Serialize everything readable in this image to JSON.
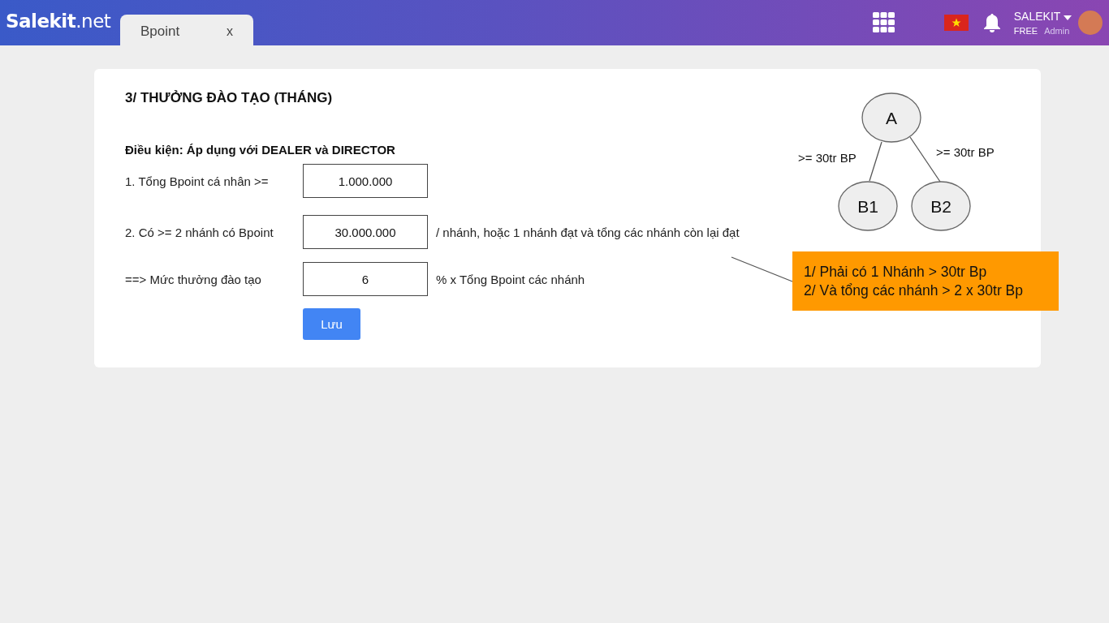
{
  "header": {
    "logo_main": "Salekit",
    "logo_suffix": ".net",
    "tabs": [
      {
        "label": "Bpoint",
        "close": "x",
        "selected": true
      }
    ],
    "user": {
      "name": "SALEKIT",
      "plan": "FREE",
      "role": "Admin"
    }
  },
  "card": {
    "title": "3/ THƯỞNG ĐÀO TẠO (THÁNG)",
    "condition": "Điều kiện: Áp dụng với DEALER và DIRECTOR",
    "rows": [
      {
        "label": "1. Tổng Bpoint cá nhân >=",
        "value": "1.000.000"
      },
      {
        "label": "2. Có >= 2 nhánh có Bpoint",
        "value": "30.000.000",
        "suffix": "/ nhánh,  hoặc 1 nhánh đạt và tổng các nhánh còn lại đạt"
      },
      {
        "label": "==> Mức thưởng đào tạo",
        "value": "6",
        "suffix": "%  x Tổng Bpoint các nhánh"
      }
    ],
    "save_button": "Lưu"
  },
  "diagram": {
    "nodes": [
      "A",
      "B1",
      "B2"
    ],
    "edge_labels": [
      ">= 30tr BP",
      ">= 30tr BP"
    ]
  },
  "callout": {
    "lines": [
      "1/ Phải có 1 Nhánh > 30tr Bp",
      "2/ Và tổng các nhánh > 2 x 30tr Bp"
    ]
  }
}
